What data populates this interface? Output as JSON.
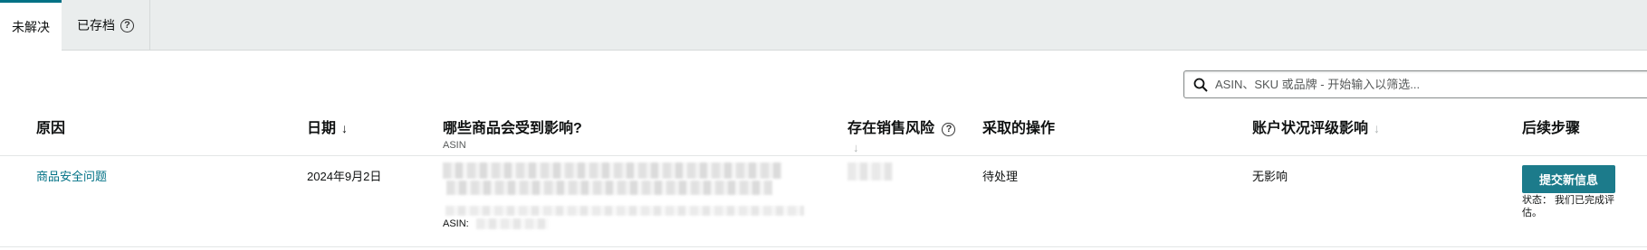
{
  "tabs": [
    {
      "label": "未解决",
      "active": true
    },
    {
      "label": "已存档",
      "active": false,
      "help_icon": "?"
    }
  ],
  "search": {
    "placeholder": "ASIN、SKU 或品牌 - 开始输入以筛选..."
  },
  "columns": {
    "reason": "原因",
    "date": "日期",
    "date_sort_icon": "↓",
    "affected": "哪些商品会受到影响?",
    "affected_sub": "ASIN",
    "risk": "存在销售风险",
    "risk_help_icon": "?",
    "risk_sort_icon": "↓",
    "action": "采取的操作",
    "account_impact": "账户状况评级影响",
    "account_sort_icon": "↓",
    "next_steps": "后续步骤"
  },
  "rows": [
    {
      "reason": "商品安全问题",
      "date": "2024年9月2日",
      "asin_label": "ASIN:",
      "action": "待处理",
      "account_impact": "无影响",
      "button": "提交新信息",
      "status": "状态： 我们已完成评估。"
    }
  ],
  "colors": {
    "accent": "#007185",
    "button": "#1c7b8b",
    "tabbar": "#eaeded"
  }
}
